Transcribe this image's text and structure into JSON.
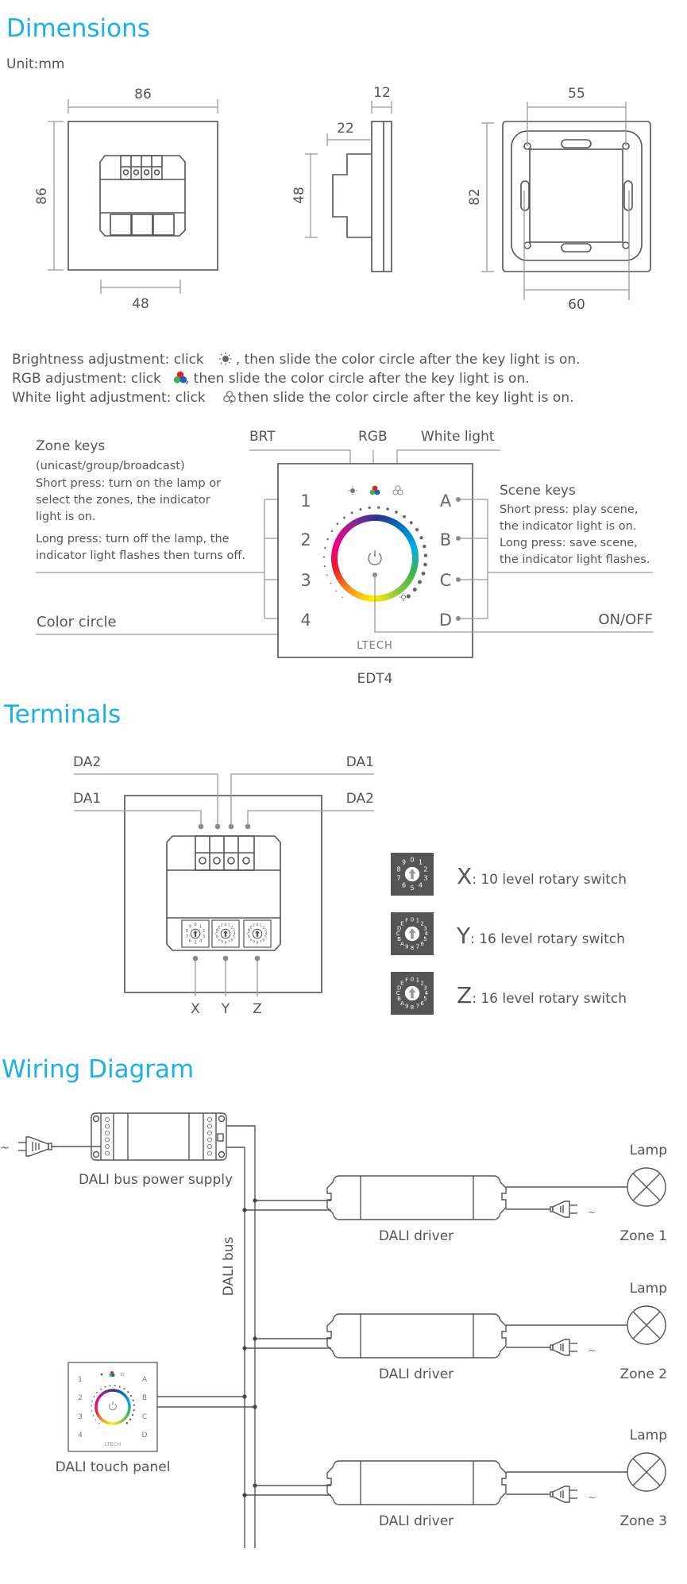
{
  "sections": {
    "dimensions": {
      "title": "Dimensions",
      "unit": "Unit:mm",
      "front_width": "86",
      "front_height": "86",
      "module_width": "48",
      "side_thickness": "12",
      "side_depth": "22",
      "side_module_height": "48",
      "back_hole_spacing": "55",
      "back_height": "82",
      "back_spacing_bottom": "60"
    },
    "instructions": {
      "brightness": {
        "before": "Brightness adjustment: click",
        "after": ", then slide the color circle after the key light is on.",
        "icon": "sun-icon"
      },
      "rgb": {
        "before": "RGB adjustment: click",
        "after": ", then slide the color circle after the key light is on.",
        "icon": "rgb-icon"
      },
      "white": {
        "before": "White light adjustment: click",
        "after": ",  then slide the color circle after the key light is on.",
        "icon": "white-light-icon"
      }
    },
    "panel": {
      "model": "EDT4",
      "brand": "LTECH",
      "brt_label": "BRT",
      "rgb_label": "RGB",
      "white_label": "White light",
      "zone_keys_title": "Zone keys",
      "zone_keys_sub": "(unicast/group/broadcast)",
      "zone_short": [
        "Short press: turn on the lamp or",
        "select the zones, the indicator",
        "light is on."
      ],
      "zone_long": [
        "Long press: turn off the lamp, the",
        "indicator light flashes then turns off."
      ],
      "color_circle": "Color circle",
      "scene_keys_title": "Scene keys",
      "scene_lines": [
        "Short press: play scene,",
        "the indicator light is on.",
        "Long press: save scene,",
        "the indicator light flashes."
      ],
      "on_off": "ON/OFF",
      "zone_key_labels": [
        "1",
        "2",
        "3",
        "4"
      ],
      "scene_key_labels": [
        "A",
        "B",
        "C",
        "D"
      ],
      "ring_colors": [
        "#2e3192",
        "#0072bc",
        "#00aeef",
        "#39b54a",
        "#8dc63f",
        "#fff200",
        "#f7941d",
        "#ed1c24",
        "#ec008c",
        "#92278f"
      ]
    },
    "terminals": {
      "title": "Terminals",
      "labels_top": [
        "DA2",
        "DA1"
      ],
      "labels_mid": [
        "DA1",
        "DA2"
      ],
      "labels_bottom": [
        "X",
        "Y",
        "Z"
      ],
      "switches": [
        {
          "letter": "X",
          "desc": ": 10 level rotary switch",
          "digits": "0123456789"
        },
        {
          "letter": "Y",
          "desc": ": 16 level rotary switch",
          "digits": "0123456789ABCDEF"
        },
        {
          "letter": "Z",
          "desc": ": 16 level rotary switch",
          "digits": "0123456789ABCDEF"
        }
      ]
    },
    "wiring": {
      "title": "Wiring Diagram",
      "power_supply": "DALI bus power supply",
      "bus": "DALI bus",
      "touch_panel": "DALI touch panel",
      "ac_symbol": "~",
      "drivers": [
        {
          "label": "DALI driver",
          "lamp": "Lamp",
          "zone": "Zone 1"
        },
        {
          "label": "DALI driver",
          "lamp": "Lamp",
          "zone": "Zone 2"
        },
        {
          "label": "DALI driver",
          "lamp": "Lamp",
          "zone": "Zone 3"
        }
      ]
    }
  }
}
